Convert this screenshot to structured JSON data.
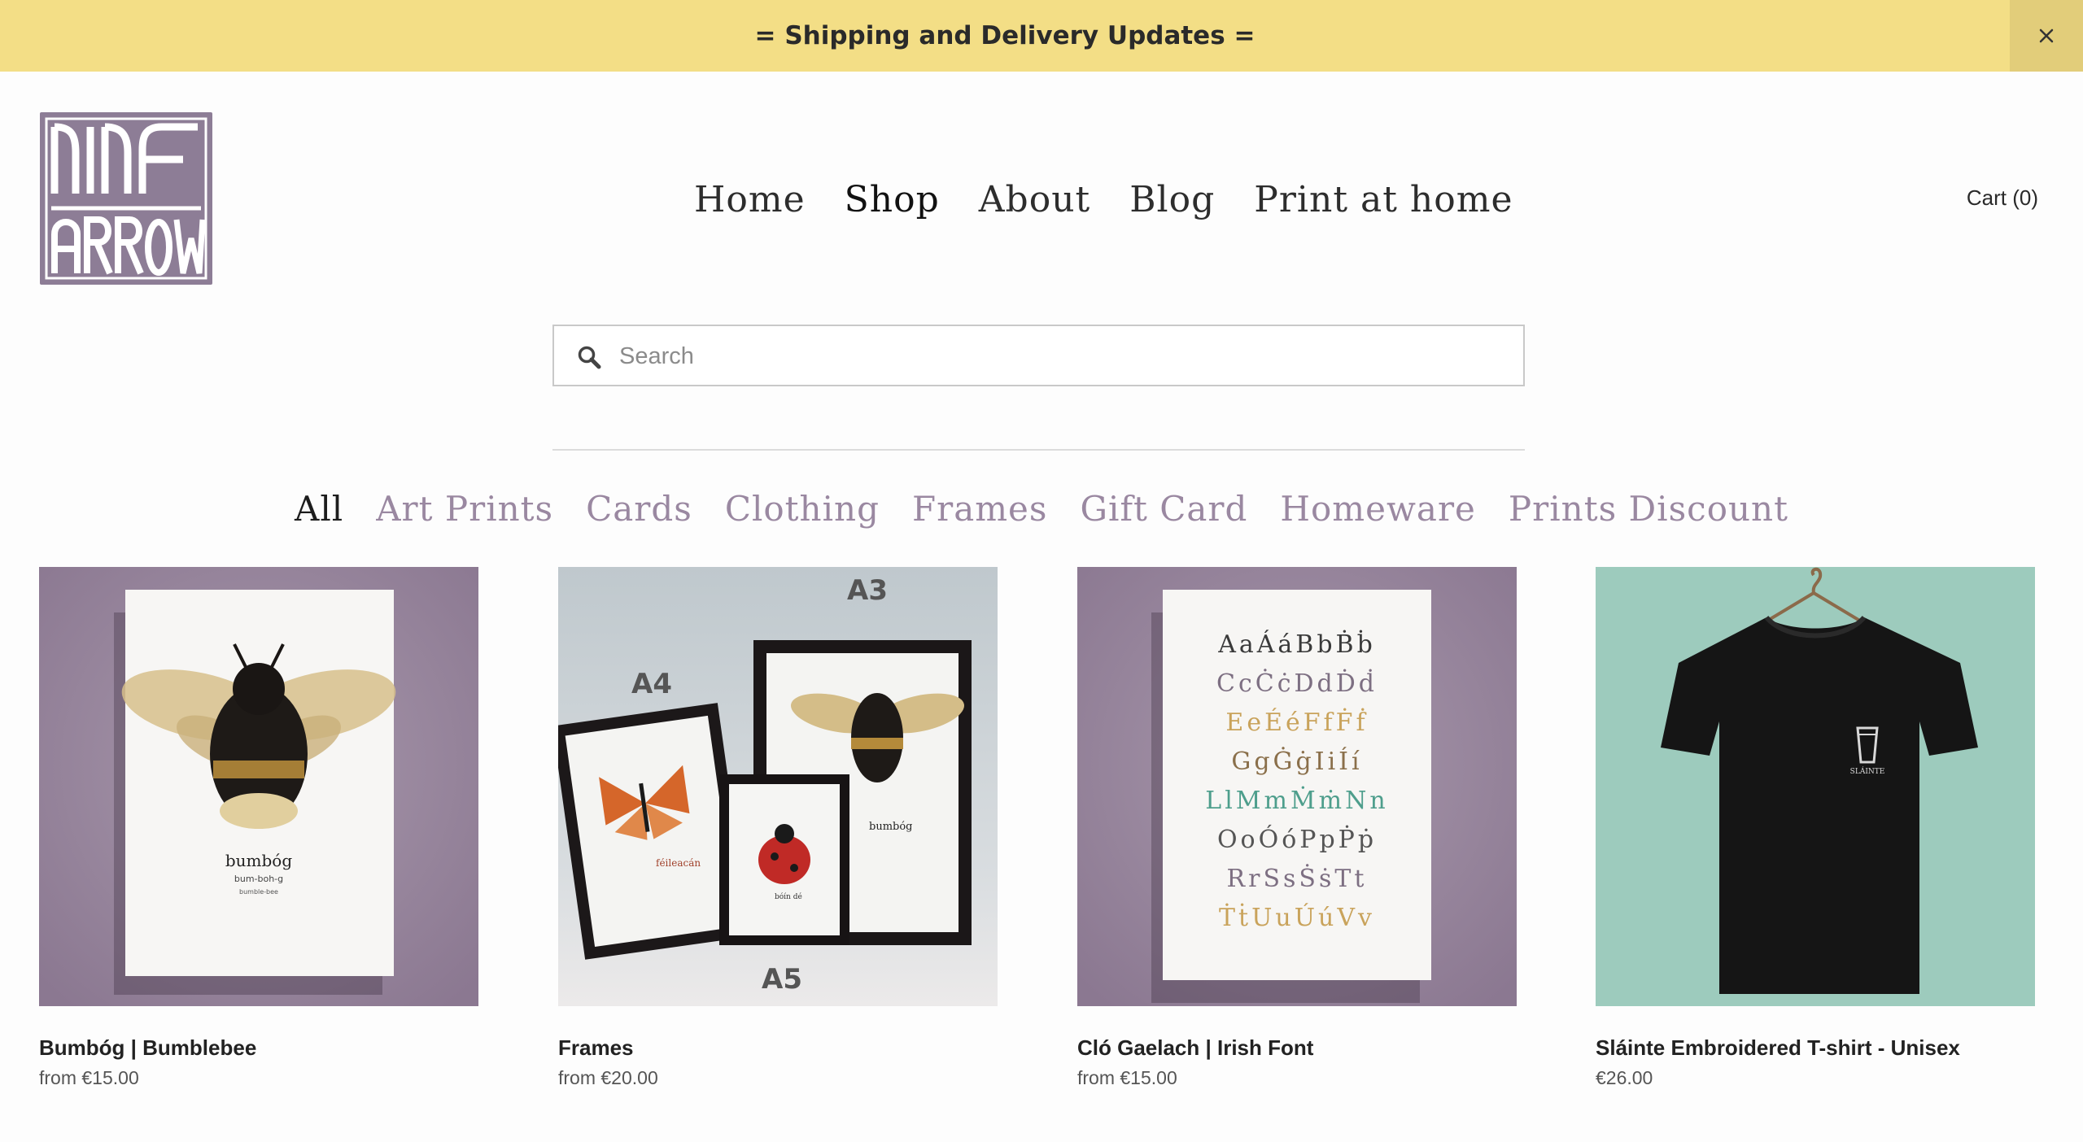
{
  "announcement": {
    "text": "= Shipping and Delivery Updates =",
    "close_icon": "close-icon"
  },
  "logo": {
    "line1": "NINE",
    "line2": "ARROW"
  },
  "nav": {
    "items": [
      "Home",
      "Shop",
      "About",
      "Blog",
      "Print at home"
    ],
    "active": "Shop"
  },
  "cart": {
    "label": "Cart (0)"
  },
  "search": {
    "placeholder": "Search",
    "value": "",
    "icon": "search-icon"
  },
  "categories": {
    "items": [
      "All",
      "Art Prints",
      "Cards",
      "Clothing",
      "Frames",
      "Gift Card",
      "Homeware",
      "Prints Discount"
    ],
    "active": "All"
  },
  "products": [
    {
      "title": "Bumbóg | Bumblebee",
      "price": "from €15.00",
      "print_word": "bumbóg",
      "print_pron": "bum-boh-g",
      "print_en": "bumble-bee",
      "bg": "#9c8a9f"
    },
    {
      "title": "Frames",
      "price": "from €20.00",
      "size_a3": "A3",
      "size_a4": "A4",
      "size_a5": "A5",
      "word_butterfly": "féileacán",
      "word_bee": "bumbóg",
      "word_ladybird": "bóín dé",
      "bg": "#c8cdd0"
    },
    {
      "title": "Cló Gaelach | Irish Font",
      "price": "from €15.00",
      "font_rows": [
        "AaÁáBbḂḃ",
        "CcĊċDdḊḋ",
        "EeÉéFfḞḟ",
        "GgĠġIiÍí",
        "LlMmṀṁNn",
        "OoÓóPpṖṗ",
        "RrSsṠṡTt",
        "ṪṫUuÚúVv"
      ],
      "bg": "#9c8a9f"
    },
    {
      "title": "Sláinte Embroidered T-shirt - Unisex",
      "price": "€26.00",
      "embroidery": "SLÁINTE",
      "bg": "#9dcbbd"
    }
  ]
}
